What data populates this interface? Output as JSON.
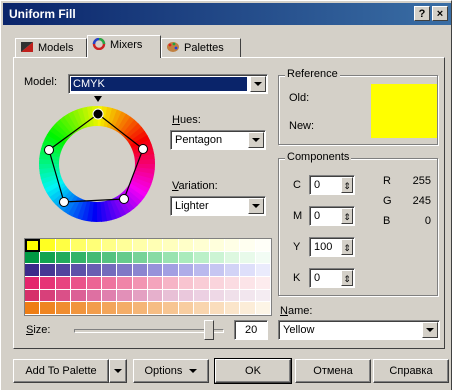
{
  "window": {
    "title": "Uniform Fill",
    "help_label": "?",
    "close_label": "×"
  },
  "tabs": [
    {
      "label": "Models"
    },
    {
      "label": "Mixers"
    },
    {
      "label": "Palettes"
    }
  ],
  "model": {
    "label": "Model:",
    "value": "CMYK"
  },
  "hues": {
    "label": "Hues:",
    "value": "Pentagon"
  },
  "variation": {
    "label": "Variation:",
    "value": "Lighter"
  },
  "reference": {
    "title": "Reference",
    "old_label": "Old:",
    "new_label": "New:",
    "new_color": "#ffff00"
  },
  "components": {
    "title": "Components",
    "c": {
      "label": "C",
      "value": "0"
    },
    "m": {
      "label": "M",
      "value": "0"
    },
    "y": {
      "label": "Y",
      "value": "100"
    },
    "k": {
      "label": "K",
      "value": "0"
    },
    "r": {
      "label": "R",
      "value": "255"
    },
    "g": {
      "label": "G",
      "value": "245"
    },
    "b": {
      "label": "B",
      "value": "0"
    }
  },
  "name": {
    "label": "Name:",
    "value": "Yellow"
  },
  "size": {
    "label": "Size:",
    "value": "20",
    "level": 0.9
  },
  "palette_rows": [
    [
      "#ffff00",
      "#ffff22",
      "#ffff44",
      "#ffff66",
      "#ffff77",
      "#ffff88",
      "#ffff99",
      "#ffffaa",
      "#ffffb4",
      "#ffffbe",
      "#ffffc8",
      "#ffffd2",
      "#ffffdc",
      "#ffffe6",
      "#fffff0",
      "#fffff8"
    ],
    [
      "#009944",
      "#11a350",
      "#22ab5c",
      "#33b368",
      "#44bb74",
      "#55c380",
      "#66cb8c",
      "#77d398",
      "#88dba4",
      "#99e3b0",
      "#aaebbc",
      "#bbf0c8",
      "#ccf4d4",
      "#ddf8e0",
      "#e8faea",
      "#f2fcf4"
    ],
    [
      "#3b2a8a",
      "#463794",
      "#52449e",
      "#5d51a8",
      "#695eb2",
      "#746bbc",
      "#8078c6",
      "#8b85d0",
      "#9792da",
      "#a29fe2",
      "#aeace8",
      "#bab9ee",
      "#c6c6f2",
      "#d2d3f6",
      "#dedffa",
      "#eaebfc"
    ],
    [
      "#e4246c",
      "#e63476",
      "#e84480",
      "#ea548a",
      "#ec6494",
      "#ee749e",
      "#f084a8",
      "#f294b2",
      "#f4a4bc",
      "#f6b4c6",
      "#f8c4d0",
      "#f9ccd6",
      "#fad4dc",
      "#fbdce2",
      "#fce4e8",
      "#fdecee"
    ],
    [
      "#ee7d14",
      "#ef8522",
      "#f08d30",
      "#f1953e",
      "#f29d4c",
      "#f3a55a",
      "#f4ad68",
      "#f5b576",
      "#f6bd84",
      "#f7c592",
      "#f8cda0",
      "#f9d5ae",
      "#faddbc",
      "#fbe5ca",
      "#fcedd8",
      "#fdf5e6"
    ]
  ],
  "buttons": {
    "add_to_palette": "Add To Palette",
    "options": "Options",
    "ok": "OK",
    "cancel": "Отмена",
    "help": "Справка"
  },
  "colors": {
    "title_bar": "#0a246a",
    "selection": "#0a246a",
    "face": "#d4d0c8"
  }
}
